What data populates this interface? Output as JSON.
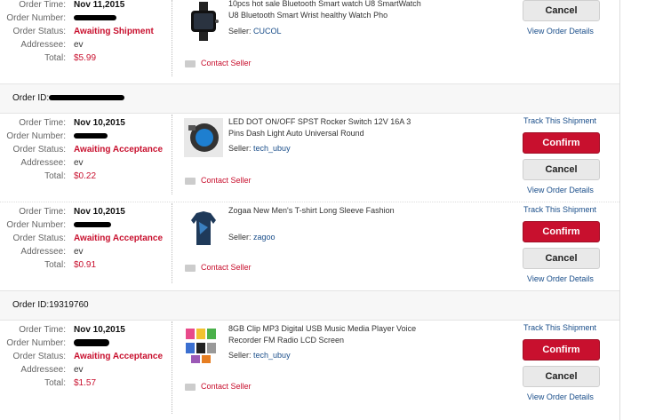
{
  "labels": {
    "order_time": "Order Time:",
    "order_number": "Order Number:",
    "order_status": "Order Status:",
    "addressee": "Addressee:",
    "total": "Total:"
  },
  "actions": {
    "contact_seller": "Contact Seller",
    "track": "Track This Shipment",
    "confirm": "Confirm",
    "cancel": "Cancel",
    "view_details": "View Order Details",
    "seller_label": "Seller:"
  },
  "orders": [
    {
      "id_label": "",
      "items": [
        {
          "order_time": "Nov 11,2015",
          "order_number": "",
          "status": "Awaiting Shipment",
          "addressee": "ev",
          "total": "$5.99",
          "title": "10pcs hot sale Bluetooth Smart watch U8 SmartWatch U8 Bluetooth Smart Wrist healthy Watch Pho",
          "seller": "CUCOL",
          "thumb_icon": "smartwatch-image"
        }
      ]
    },
    {
      "id_label": "Order ID:",
      "items": [
        {
          "order_time": "Nov 10,2015",
          "order_number": "",
          "status": "Awaiting Acceptance",
          "addressee": "ev",
          "total": "$0.22",
          "title": "LED DOT ON/OFF SPST Rocker Switch 12V 16A 3 Pins Dash Light Auto Universal Round",
          "seller": "tech_ubuy",
          "thumb_icon": "rocker-switch-image"
        },
        {
          "order_time": "Nov 10,2015",
          "order_number": "",
          "status": "Awaiting Acceptance",
          "addressee": "ev",
          "total": "$0.91",
          "title": "Zogaa New Men's T-shirt Long Sleeve Fashion",
          "seller": "zagoo",
          "thumb_icon": "tshirt-image"
        }
      ]
    },
    {
      "id_label": "Order ID:19319760",
      "items": [
        {
          "order_time": "Nov 10,2015",
          "order_number": "",
          "status": "Awaiting Acceptance",
          "addressee": "ev",
          "total": "$1.57",
          "title": "8GB Clip MP3 Digital USB Music Media Player Voice Recorder FM Radio LCD Screen",
          "seller": "tech_ubuy",
          "thumb_icon": "mp3-player-image"
        }
      ]
    }
  ],
  "colors": {
    "accent_red": "#c8102e",
    "link_blue": "#1a4e8a"
  }
}
